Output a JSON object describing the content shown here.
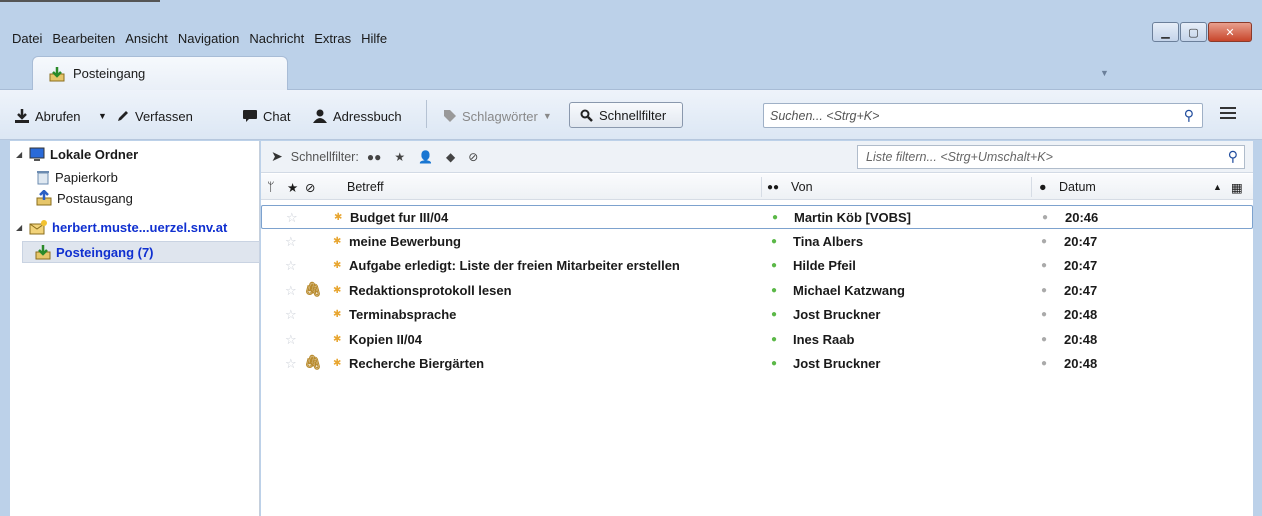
{
  "menu": [
    "Datei",
    "Bearbeiten",
    "Ansicht",
    "Navigation",
    "Nachricht",
    "Extras",
    "Hilfe"
  ],
  "tab": {
    "label": "Posteingang"
  },
  "toolbar": {
    "get": "Abrufen",
    "write": "Verfassen",
    "chat": "Chat",
    "addressbook": "Adressbuch",
    "tags": "Schlagwörter",
    "quickfilter": "Schnellfilter",
    "search_placeholder": "Suchen... <Strg+K>"
  },
  "folders": {
    "local": "Lokale Ordner",
    "trash": "Papierkorb",
    "outbox": "Postausgang",
    "account": "herbert.muste...uerzel.snv.at",
    "inbox": "Posteingang (7)"
  },
  "quickfilter_bar": {
    "label": "Schnellfilter:",
    "filter_placeholder": "Liste filtern... <Strg+Umschalt+K>"
  },
  "columns": {
    "subject": "Betreff",
    "from": "Von",
    "date": "Datum"
  },
  "messages": [
    {
      "subject": "Budget fur III/04",
      "from": "Martin Köb [VOBS]",
      "date": "20:46",
      "attachment": false
    },
    {
      "subject": "meine Bewerbung",
      "from": "Tina Albers",
      "date": "20:47",
      "attachment": false
    },
    {
      "subject": "Aufgabe erledigt: Liste der freien Mitarbeiter erstellen",
      "from": "Hilde Pfeil",
      "date": "20:47",
      "attachment": false
    },
    {
      "subject": "Redaktionsprotokoll lesen",
      "from": "Michael Katzwang",
      "date": "20:47",
      "attachment": true
    },
    {
      "subject": "Terminabsprache",
      "from": "Jost Bruckner",
      "date": "20:48",
      "attachment": false
    },
    {
      "subject": "Kopien II/04",
      "from": "Ines Raab",
      "date": "20:48",
      "attachment": false
    },
    {
      "subject": "Recherche Biergärten",
      "from": "Jost Bruckner",
      "date": "20:48",
      "attachment": true
    }
  ],
  "colors": {
    "accent": "#1030d0",
    "frame": "#bcd1e9",
    "unread_dot": "#e8a631",
    "contact_dot": "#5bb848"
  }
}
